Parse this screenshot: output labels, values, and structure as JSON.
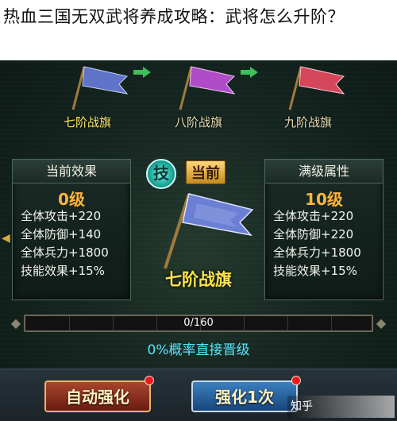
{
  "title": "热血三国无双武将养成攻略：武将怎么升阶？",
  "flags": {
    "skill_icon": "技",
    "current_tag": "当前",
    "items": [
      {
        "label": "七阶战旗",
        "color": "#5f73c9"
      },
      {
        "label": "八阶战旗",
        "color": "#b14cc8"
      },
      {
        "label": "九阶战旗",
        "color": "#d5465a"
      }
    ]
  },
  "current_panel": {
    "header": "当前效果",
    "level": "0级",
    "stats": [
      "全体攻击+220",
      "全体防御+140",
      "全体兵力+1800",
      "技能效果+15%"
    ]
  },
  "center": {
    "skill_icon": "技",
    "current_tag": "当前",
    "flag_label": "七阶战旗"
  },
  "max_panel": {
    "header": "满级属性",
    "level": "10级",
    "stats": [
      "全体攻击+220",
      "全体防御+220",
      "全体兵力+1800",
      "技能效果+15%"
    ]
  },
  "progress": {
    "text": "0/160",
    "value": 0
  },
  "probability_text": "0%概率直接晋级",
  "buttons": {
    "auto": "自动强化",
    "once": "强化1次"
  },
  "watermark": "知乎",
  "colors": {
    "accent_gold": "#ffb33c",
    "cyan": "#58e6ff",
    "flag_yellow": "#ffe24a"
  }
}
